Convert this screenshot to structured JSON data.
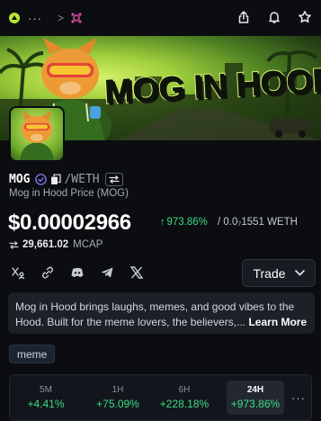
{
  "topbar": {
    "more_label": "···",
    "separator": ">",
    "icons": [
      "app-logo-icon",
      "chain-icon",
      "share-icon",
      "bell-icon",
      "star-icon"
    ]
  },
  "banner": {
    "title": "MOG IN HOOD"
  },
  "token": {
    "symbol": "MOG",
    "quote": "/WETH",
    "subtitle": "Mog in Hood Price (MOG)",
    "price": "$0.00002966",
    "change_24h": "973.86%",
    "pair_price": "/ 0.0₇1551 WETH",
    "market_cap": "29,661.02",
    "market_cap_label": "MCAP"
  },
  "socials": [
    "x-community-icon",
    "link-icon",
    "discord-icon",
    "telegram-icon",
    "x-icon"
  ],
  "trade_button": {
    "label": "Trade"
  },
  "description": {
    "text": "Mog in Hood brings laughs, memes, and good vibes to the Hood. Built for the meme lovers, the believers,...",
    "learn_more": "Learn More"
  },
  "tags": [
    "meme"
  ],
  "stats": {
    "periods": [
      {
        "label": "5M",
        "value": "+4.41%"
      },
      {
        "label": "1H",
        "value": "+75.09%"
      },
      {
        "label": "6H",
        "value": "+228.18%"
      },
      {
        "label": "24H",
        "value": "+973.86%"
      }
    ],
    "selected": "24H",
    "more_label": "···"
  },
  "colors": {
    "background": "#0b0d11",
    "positive": "#3ddc84",
    "accent_green": "#b8e832",
    "verified": "#8b7cf6"
  }
}
